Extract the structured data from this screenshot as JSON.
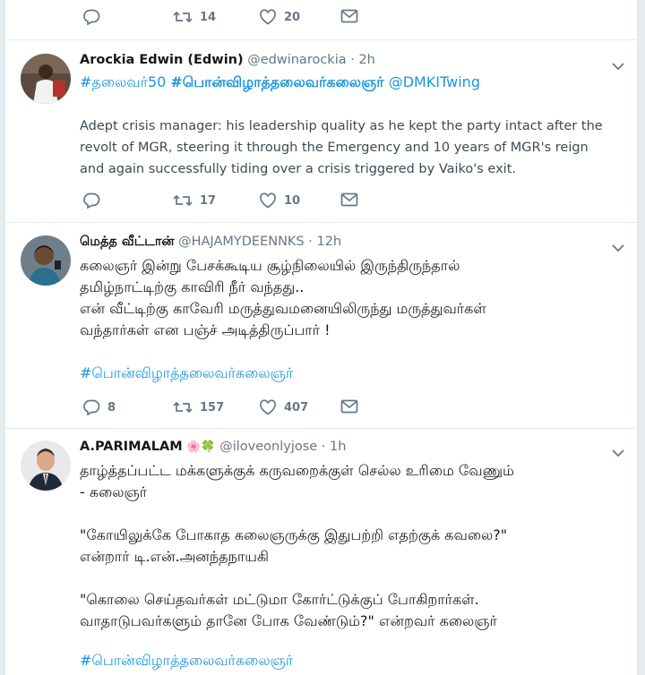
{
  "top_actions": {
    "reply": "",
    "retweets": "14",
    "likes": "20"
  },
  "tweets": [
    {
      "name": "Arockia Edwin (Edwin)",
      "handle": "@edwinarockia",
      "sep": " · ",
      "time": "2h",
      "tag1": "#தலைவர்50",
      "tag2": "#பொன்விழாத்தலைவர்கலைஞர்",
      "mention": "@DMKITwing",
      "text": "Adept crisis manager: his leadership quality as he kept the party intact after the\nrevolt of MGR, steering it through the Emergency and 10 years of MGR's reign\nand again successfully tiding over a crisis triggered by Vaiko's exit.",
      "replies": "",
      "retweets": "17",
      "likes": "10"
    },
    {
      "name": "மெத்த வீட்டான்",
      "handle": "@HAJAMYDEENNKS",
      "sep": " · ",
      "time": "12h",
      "text": "கலைஞர் இன்று பேசக்கூடிய சூழ்நிலையில் இருந்திருந்தால்\nதமிழ்நாட்டிற்கு காவிரி நீர் வந்தது..\nஎன் வீட்டிற்கு காவேரி மருத்துவமனையிலிருந்து மருத்துவர்கள்\nவந்தார்கள் என பஞ்ச் அடித்திருப்பார் !",
      "tag": "#பொன்விழாத்தலைவர்கலைஞர்",
      "replies": "8",
      "retweets": "157",
      "likes": "407"
    },
    {
      "name": "A.PARIMALAM",
      "emoji": "🌸🍀",
      "handle": "@iloveonlyjose",
      "sep": " · ",
      "time": "1h",
      "text": "தாழ்த்தப்பட்ட மக்களுக்குக் கருவறைக்குள் செல்ல உரிமை வேணும்\n- கலைஞர்\n\n\"கோயிலுக்கே போகாத கலைஞருக்கு இதுபற்றி எதற்குக் கவலை?\"\nஎன்றார் டி.என்.அனந்தநாயகி\n\n\"கொலை செய்தவர்கள் மட்டுமா கோர்ட்டுக்குப் போகிறார்கள்.\nவாதாடுபவர்களும் தானே போக வேண்டும்?\" என்றவர் கலைஞர்",
      "tag": "#பொன்விழாத்தலைவர்கலைஞர்"
    }
  ],
  "colors": {
    "link": "#1b95e0",
    "meta": "#657786",
    "divider": "#e6ecf0"
  },
  "icons": [
    "reply-icon",
    "retweet-icon",
    "like-icon",
    "message-icon",
    "chevron-down-icon"
  ]
}
